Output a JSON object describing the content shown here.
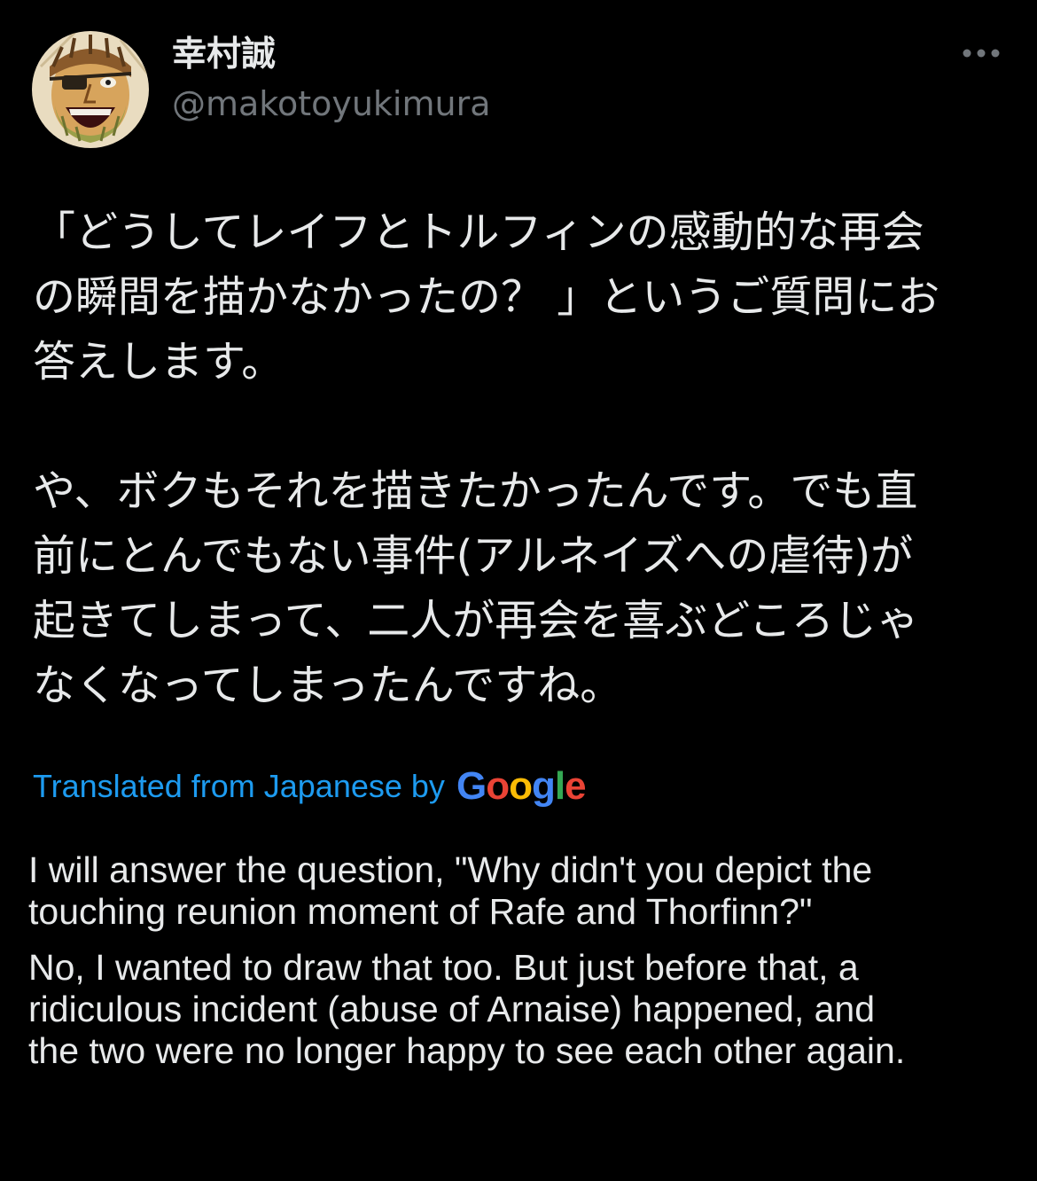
{
  "author": {
    "display_name": "幸村誠",
    "handle": "@makotoyukimura",
    "avatar_icon": "avatar-image"
  },
  "more_menu": {
    "icon": "more-horizontal-icon"
  },
  "tweet": {
    "paragraph_1": [
      "「どうしてレイフとトルフィンの感動的な再会",
      "の瞬間を描かなかったの？ 」というご質問にお",
      "答えします。"
    ],
    "paragraph_2": [
      "や、ボクもそれを描きたかったんです。でも直",
      "前にとんでもない事件(アルネイズへの虐待)が",
      "起きてしまって、二人が再会を喜ぶどころじゃ",
      "なくなってしまったんですね。"
    ]
  },
  "translation": {
    "label": "Translated from Japanese by",
    "provider_letters": [
      "G",
      "o",
      "o",
      "g",
      "l",
      "e"
    ],
    "provider_colors": [
      "#4285F4",
      "#EA4335",
      "#FBBC05",
      "#4285F4",
      "#34A853",
      "#EA4335"
    ],
    "paragraph_1": [
      "I will answer the question, \"Why didn't you depict the",
      "touching reunion moment of Rafe and Thorfinn?\""
    ],
    "paragraph_2": [
      "No, I wanted to draw that too. But just before that, a",
      "ridiculous incident (abuse of Arnaise) happened, and",
      "the two were no longer happy to see each other again."
    ]
  },
  "colors": {
    "background": "#000000",
    "text_primary": "#e7e9ea",
    "text_secondary": "#71767b",
    "link": "#1d9bf0"
  }
}
